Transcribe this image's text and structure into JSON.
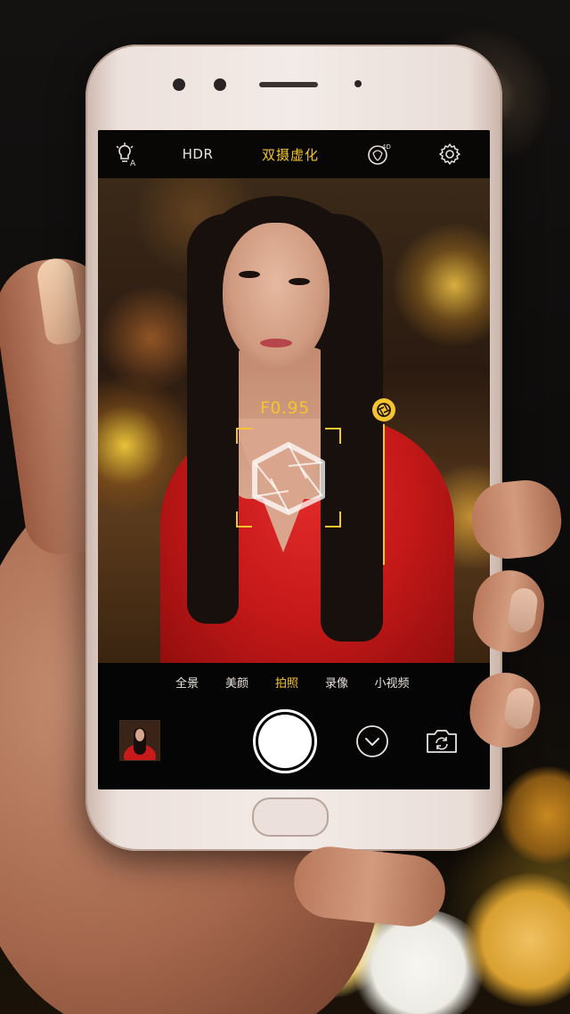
{
  "topbar": {
    "flash_icon": "flash-auto-icon",
    "hdr_label": "HDR",
    "mode_title": "双摄虚化",
    "effect_icon": "4d-portrait-icon",
    "settings_icon": "gear-icon"
  },
  "viewfinder": {
    "aperture_value": "F0.95",
    "aperture_slider_icon": "aperture-icon",
    "focus_icon": "aperture-blade-icon"
  },
  "modes": {
    "items": [
      "全景",
      "美颜",
      "拍照",
      "录像",
      "小视频"
    ],
    "active": "拍照"
  },
  "controls": {
    "gallery_icon": "gallery-thumbnail",
    "shutter_icon": "shutter-button",
    "more_icon": "chevron-down-icon",
    "switch_icon": "camera-switch-icon"
  },
  "colors": {
    "accent": "#f4c430",
    "bar_background": "#080706",
    "text": "#e9e4e0"
  }
}
